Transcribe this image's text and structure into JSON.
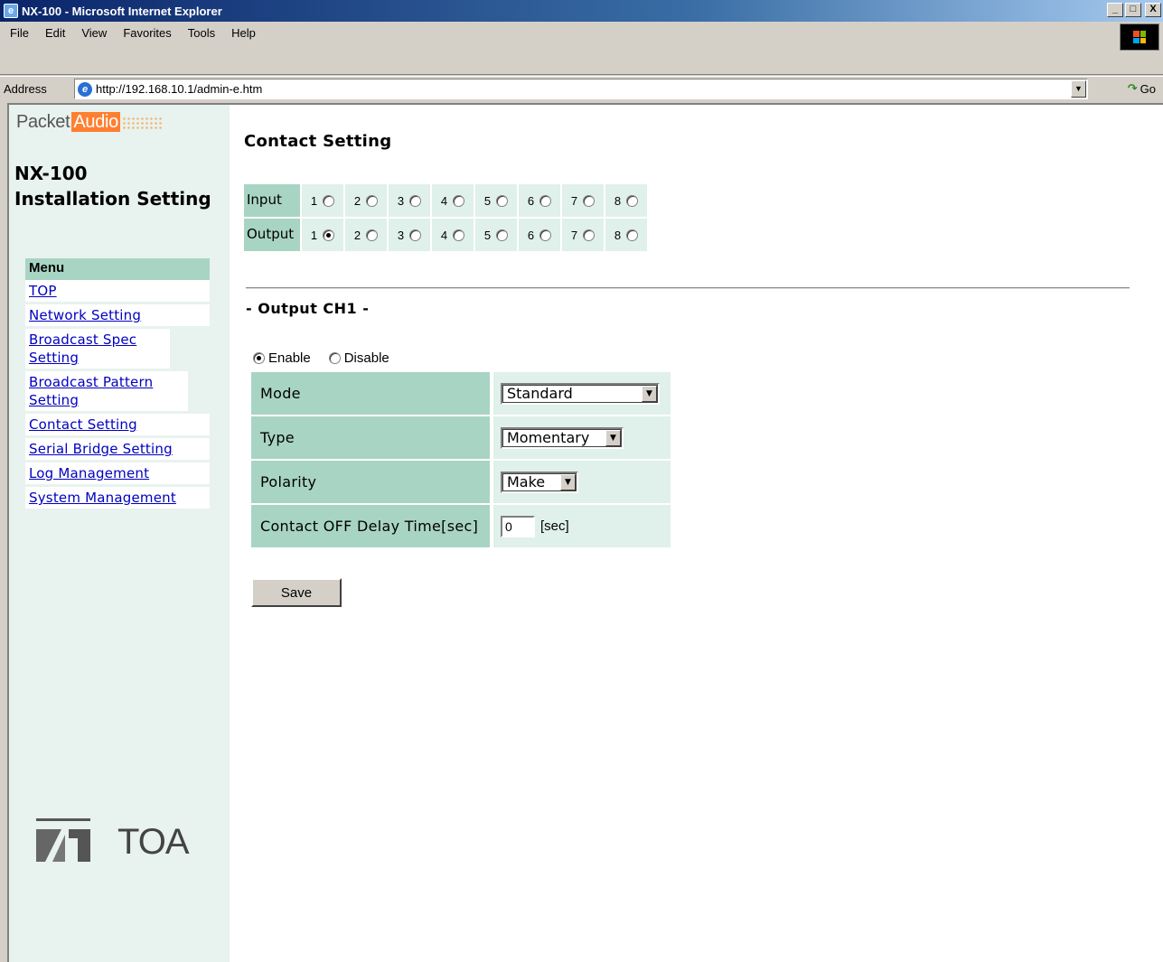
{
  "window": {
    "title": "NX-100 - Microsoft Internet Explorer",
    "min": "_",
    "max": "□",
    "close": "X"
  },
  "menubar": {
    "items": [
      "File",
      "Edit",
      "View",
      "Favorites",
      "Tools",
      "Help"
    ]
  },
  "address": {
    "label": "Address",
    "url": "http://192.168.10.1/admin-e.htm",
    "go_label": "Go"
  },
  "sidebar": {
    "brand_packet": "Packet",
    "brand_audio": "Audio",
    "product_line1": "NX-100",
    "product_line2": "Installation Setting",
    "menu_title": "Menu",
    "items": [
      {
        "label": "TOP"
      },
      {
        "label": "Network Setting"
      },
      {
        "label": "Broadcast Spec Setting"
      },
      {
        "label": "Broadcast Pattern Setting"
      },
      {
        "label": "Contact Setting"
      },
      {
        "label": "Serial Bridge Setting"
      },
      {
        "label": "Log Management"
      },
      {
        "label": "System Management"
      }
    ],
    "logo_text": "TOA"
  },
  "main": {
    "title": "Contact Setting",
    "input_label": "Input",
    "output_label": "Output",
    "channels": [
      "1",
      "2",
      "3",
      "4",
      "5",
      "6",
      "7",
      "8"
    ],
    "input_selected": null,
    "output_selected": "1",
    "section_title": "- Output CH1 -",
    "enable_label": "Enable",
    "disable_label": "Disable",
    "enabled": true,
    "settings": {
      "mode_label": "Mode",
      "mode_value": "Standard",
      "type_label": "Type",
      "type_value": "Momentary",
      "polarity_label": "Polarity",
      "polarity_value": "Make",
      "delay_label": "Contact OFF Delay Time[sec]",
      "delay_value": "0",
      "delay_unit": "[sec]"
    },
    "save_label": "Save"
  }
}
